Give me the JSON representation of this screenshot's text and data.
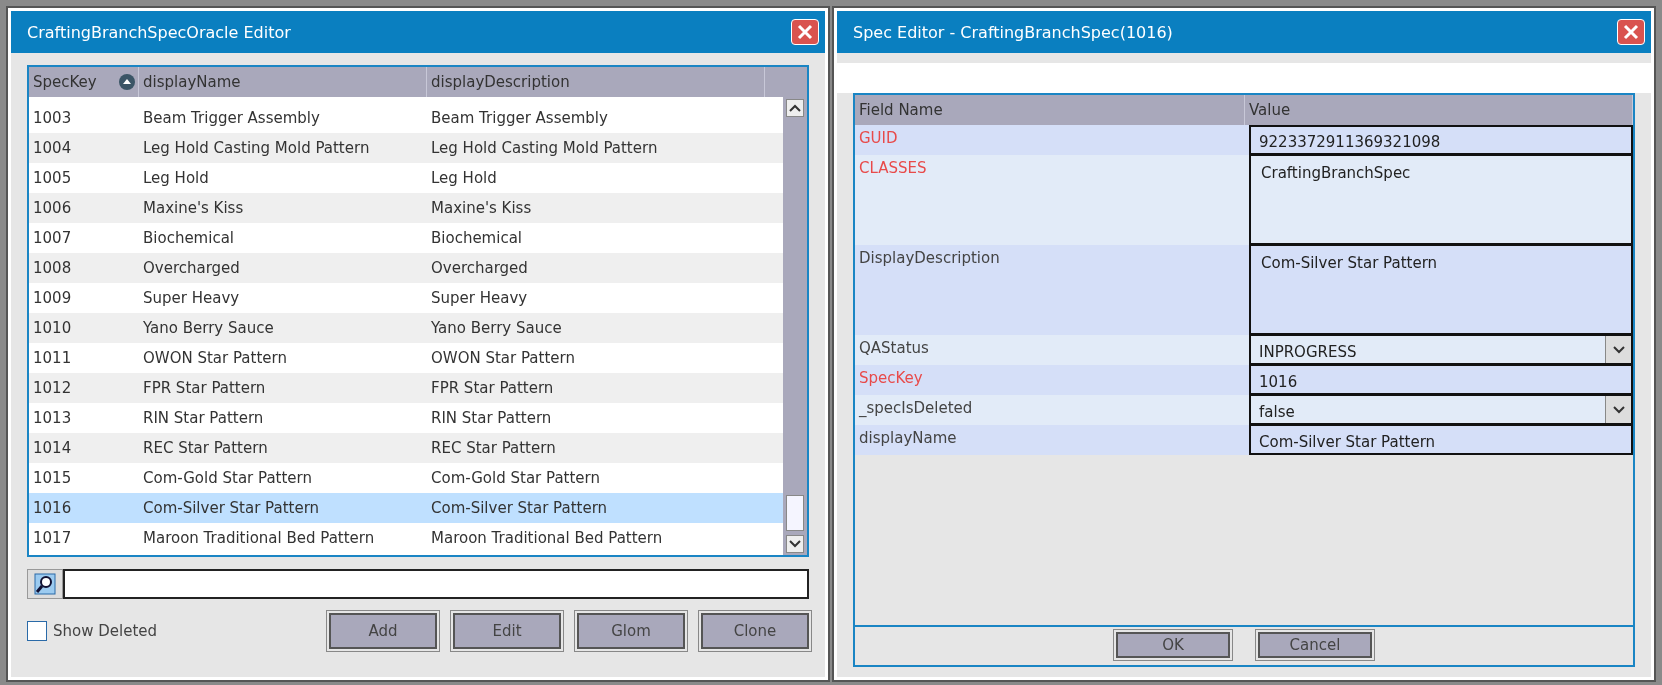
{
  "list_window": {
    "title": "CraftingBranchSpecOracle Editor",
    "table": {
      "columns": [
        {
          "label": "SpecKey",
          "sorted": true
        },
        {
          "label": "displayName",
          "sorted": false
        },
        {
          "label": "displayDescription",
          "sorted": false
        }
      ],
      "rows": [
        {
          "cells": [
            "1003",
            "Beam Trigger Assembly",
            "Beam Trigger Assembly"
          ],
          "selected": false
        },
        {
          "cells": [
            "1004",
            "Leg Hold Casting Mold Pattern",
            "Leg Hold Casting Mold Pattern"
          ],
          "selected": false
        },
        {
          "cells": [
            "1005",
            "Leg Hold",
            "Leg Hold"
          ],
          "selected": false
        },
        {
          "cells": [
            "1006",
            "Maxine's Kiss",
            "Maxine's Kiss"
          ],
          "selected": false
        },
        {
          "cells": [
            "1007",
            "Biochemical",
            "Biochemical"
          ],
          "selected": false
        },
        {
          "cells": [
            "1008",
            "Overcharged",
            "Overcharged"
          ],
          "selected": false
        },
        {
          "cells": [
            "1009",
            "Super Heavy",
            "Super Heavy"
          ],
          "selected": false
        },
        {
          "cells": [
            "1010",
            "Yano Berry Sauce",
            "Yano Berry Sauce"
          ],
          "selected": false
        },
        {
          "cells": [
            "1011",
            "OWON Star Pattern",
            "OWON Star Pattern"
          ],
          "selected": false
        },
        {
          "cells": [
            "1012",
            "FPR Star Pattern",
            "FPR Star Pattern"
          ],
          "selected": false
        },
        {
          "cells": [
            "1013",
            "RIN Star Pattern",
            "RIN Star Pattern"
          ],
          "selected": false
        },
        {
          "cells": [
            "1014",
            "REC Star Pattern",
            "REC Star Pattern"
          ],
          "selected": false
        },
        {
          "cells": [
            "1015",
            "Com-Gold Star Pattern",
            "Com-Gold Star Pattern"
          ],
          "selected": false
        },
        {
          "cells": [
            "1016",
            "Com-Silver Star Pattern",
            "Com-Silver Star Pattern"
          ],
          "selected": true
        },
        {
          "cells": [
            "1017",
            "Maroon Traditional Bed Pattern",
            "Maroon Traditional Bed Pattern"
          ],
          "selected": false
        }
      ]
    },
    "show_deleted": {
      "label": "Show Deleted",
      "checked": false
    },
    "buttons": [
      "Add",
      "Edit",
      "Glom",
      "Clone"
    ]
  },
  "spec_window": {
    "title": "Spec Editor - CraftingBranchSpec(1016)",
    "columns": [
      "Field Name",
      "Value"
    ],
    "fields": [
      {
        "name": "GUID",
        "required": true,
        "kind": "text",
        "value": "9223372911369321098"
      },
      {
        "name": "CLASSES",
        "required": true,
        "kind": "textarea",
        "value": "CraftingBranchSpec"
      },
      {
        "name": "DisplayDescription",
        "required": false,
        "kind": "textarea",
        "value": "Com-Silver Star Pattern"
      },
      {
        "name": "QAStatus",
        "required": false,
        "kind": "dropdown",
        "value": "INPROGRESS"
      },
      {
        "name": "SpecKey",
        "required": true,
        "kind": "text",
        "value": "1016"
      },
      {
        "name": "_specIsDeleted",
        "required": false,
        "kind": "dropdown",
        "value": "false"
      },
      {
        "name": "displayName",
        "required": false,
        "kind": "text",
        "value": "Com-Silver Star Pattern"
      }
    ],
    "buttons": [
      "OK",
      "Cancel"
    ]
  }
}
